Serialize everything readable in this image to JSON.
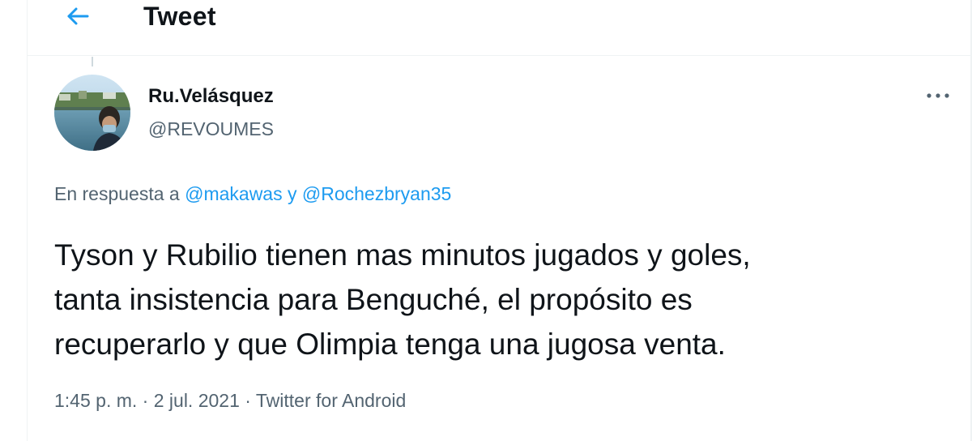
{
  "header": {
    "back_icon": "arrow-left-icon",
    "title": "Tweet"
  },
  "tweet": {
    "author": {
      "name": "Ru.Velásquez",
      "handle": "@REVOUMES",
      "avatar_description": "profile-photo"
    },
    "more_icon": "more-horizontal-icon",
    "reply": {
      "prefix": "En respuesta a ",
      "mention_1": "@makawas",
      "conjunction": " y ",
      "mention_2": "@Rochezbryan35"
    },
    "text": "Tyson y Rubilio tienen mas minutos jugados y goles,\ntanta insistencia para Benguché, el propósito es\nrecuperarlo y que Olimpia tenga una jugosa venta.",
    "meta": {
      "time": "1:45 p. m.",
      "separator_1": " · ",
      "date": "2 jul. 2021",
      "separator_2": " · ",
      "source": "Twitter for Android"
    }
  },
  "colors": {
    "accent": "#1d9bf0",
    "text_primary": "#0f1419",
    "text_secondary": "#536471",
    "divider": "#eff3f4"
  }
}
